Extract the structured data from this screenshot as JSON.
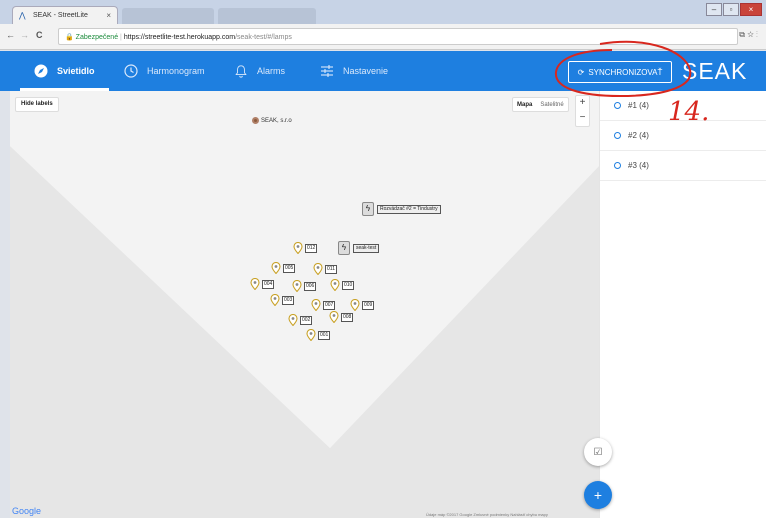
{
  "browser": {
    "tab_title": "SEAK - StreetLite",
    "tab_close": "×",
    "secure_label": "Zabezpečené",
    "url_host": "https://streetlite-test.herokuapp.com",
    "url_path": "/seak-test/#/lamps",
    "back": "←",
    "forward": "→",
    "reload": "C",
    "star": "☆",
    "menu": "⋮"
  },
  "header": {
    "menu": [
      {
        "label": "Svietidlo",
        "icon": "compass-icon",
        "active": true
      },
      {
        "label": "Harmonogram",
        "icon": "clock-icon",
        "active": false
      },
      {
        "label": "Alarms",
        "icon": "bell-icon",
        "active": false
      },
      {
        "label": "Nastavenie",
        "icon": "sliders-icon",
        "active": false
      }
    ],
    "sync_label": "SYNCHRONIZOVAŤ",
    "brand": "SEAK"
  },
  "map": {
    "hide_labels": "Hide labels",
    "map_type": {
      "map": "Mapa",
      "satellite": "Satelitné"
    },
    "zoom_in": "+",
    "zoom_out": "−",
    "poi_label": "SEAK, s.r.o",
    "switches": [
      {
        "label": "Rozvádzač #2 = Tindustry"
      },
      {
        "label": "seak-test"
      }
    ],
    "lamps": [
      "012",
      "005",
      "011",
      "004",
      "006",
      "010",
      "003",
      "007",
      "009",
      "002",
      "008",
      "001"
    ],
    "google": "Google",
    "footer": "Údaje máp ©2017 Google   Zmluvné podmienky   Nahlásiť chybu mapy"
  },
  "panel": {
    "items": [
      {
        "label": "#1 (4)"
      },
      {
        "label": "#2 (4)"
      },
      {
        "label": "#3 (4)"
      }
    ]
  },
  "annotation": {
    "text": "14.",
    "color": "#d8271e"
  },
  "colors": {
    "primary": "#1e7fe0",
    "annotation": "#d8271e"
  }
}
